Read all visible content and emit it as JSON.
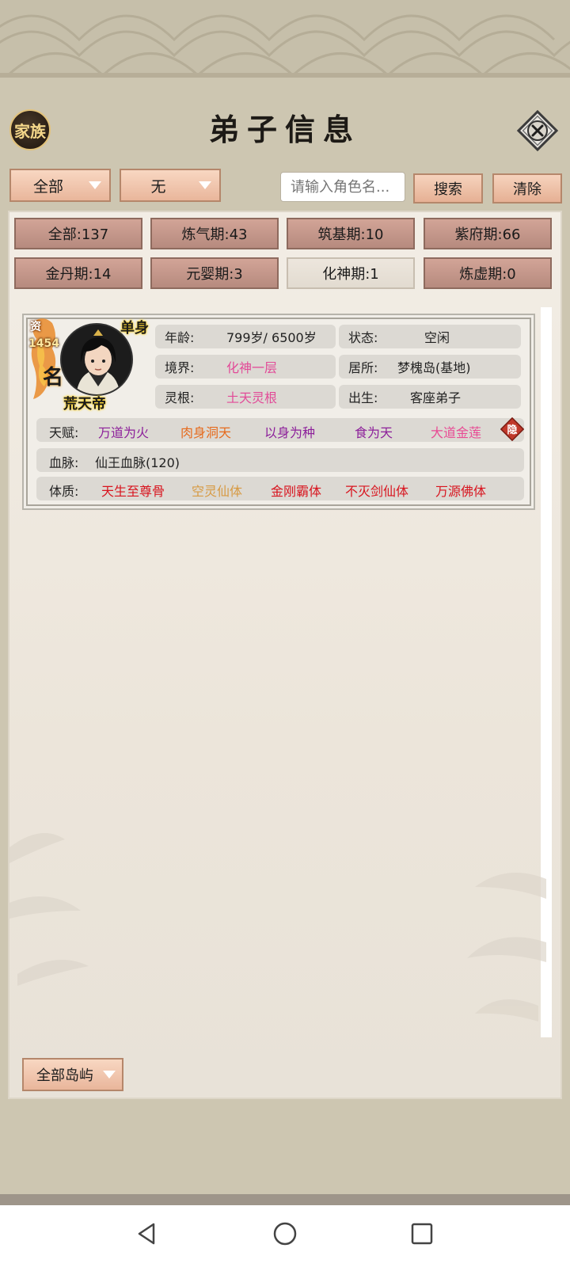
{
  "header": {
    "clan_label": "家族",
    "title": "弟子信息",
    "close_icon": "close-icon"
  },
  "filters": {
    "category_selected": "全部",
    "secondary_selected": "无",
    "search_placeholder": "请输入角色名...",
    "search_label": "搜索",
    "clear_label": "清除"
  },
  "stages": [
    {
      "label": "全部:137"
    },
    {
      "label": "炼气期:43"
    },
    {
      "label": "筑基期:10"
    },
    {
      "label": "紫府期:66"
    },
    {
      "label": "金丹期:14"
    },
    {
      "label": "元婴期:3"
    },
    {
      "label": "化神期:1",
      "selected": true
    },
    {
      "label": "炼虚期:0"
    }
  ],
  "disciple": {
    "aptitude_label": "资",
    "aptitude_value": "1454",
    "fame_label": "名",
    "marital": "单身",
    "name": "荒天帝",
    "age_key": "年龄:",
    "age_value": "799岁/ 6500岁",
    "status_key": "状态:",
    "status_value": "空闲",
    "realm_key": "境界:",
    "realm_value": "化神一层",
    "residence_key": "居所:",
    "residence_value": "梦槐岛(基地)",
    "root_key": "灵根:",
    "root_value": "土天灵根",
    "origin_key": "出生:",
    "origin_value": "客座弟子",
    "talent_key": "天赋:",
    "talents": [
      "万道为火",
      "肉身洞天",
      "以身为种",
      "食为天",
      "大道金莲"
    ],
    "hide_label": "隐",
    "bloodline_key": "血脉:",
    "bloodline_value": "仙王血脉(120)",
    "physique_key": "体质:",
    "physiques": [
      "天生至尊骨",
      "空灵仙体",
      "金刚霸体",
      "不灭剑仙体",
      "万源佛体"
    ]
  },
  "island_filter": {
    "selected": "全部岛屿"
  },
  "colors": {
    "pink": "#e24b98",
    "purple": "#8c1f9a",
    "orange": "#e66a1c",
    "red": "#d8141e",
    "gold": "#d79a43",
    "button": "#e9b69b",
    "stage_button": "#b68a7e"
  }
}
